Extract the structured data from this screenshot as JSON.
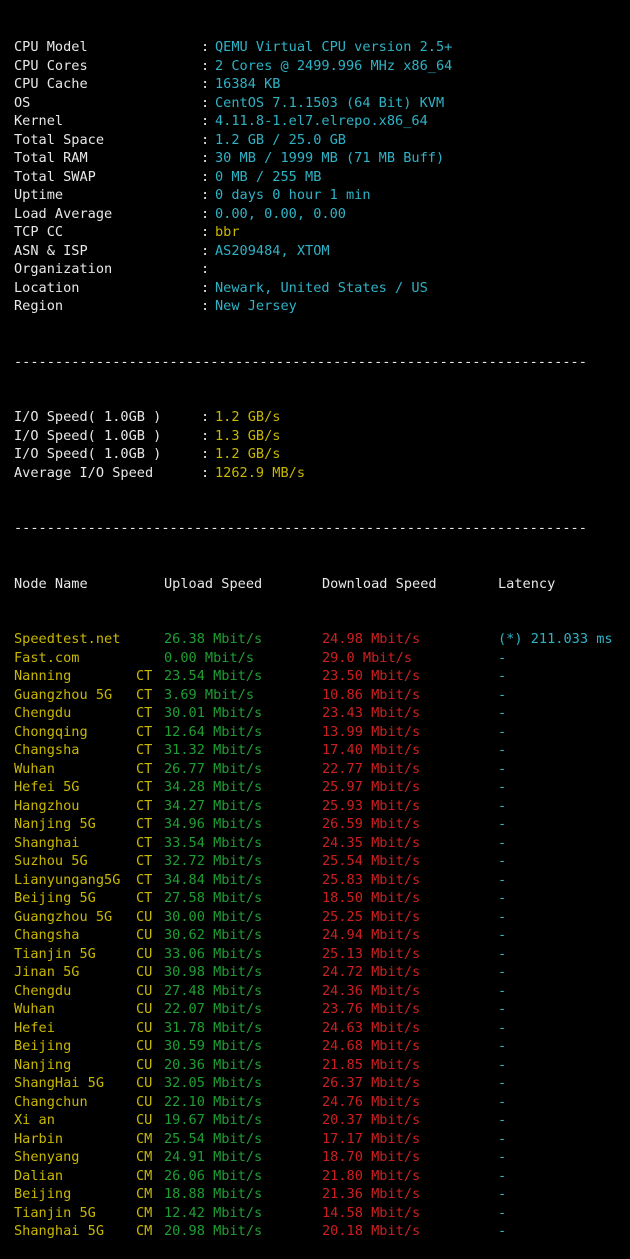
{
  "colors": {
    "background": "#000000",
    "label": "#e8e8e8",
    "value_yellow": "#c9b800",
    "value_cyan": "#2fb2c5",
    "upload_green": "#1f9e33",
    "download_red": "#cc2020"
  },
  "colon": ":",
  "system_info": [
    {
      "label": "CPU Model",
      "value": "QEMU Virtual CPU version 2.5+",
      "color": "cyan"
    },
    {
      "label": "CPU Cores",
      "value": "2 Cores @ 2499.996 MHz x86_64",
      "color": "cyan"
    },
    {
      "label": "CPU Cache",
      "value": "16384 KB",
      "color": "cyan"
    },
    {
      "label": "OS",
      "value": "CentOS 7.1.1503 (64 Bit) KVM",
      "color": "cyan"
    },
    {
      "label": "Kernel",
      "value": "4.11.8-1.el7.elrepo.x86_64",
      "color": "cyan"
    },
    {
      "label": "Total Space",
      "value": "1.2 GB / 25.0 GB",
      "color": "cyan"
    },
    {
      "label": "Total RAM",
      "value": "30 MB / 1999 MB (71 MB Buff)",
      "color": "cyan"
    },
    {
      "label": "Total SWAP",
      "value": "0 MB / 255 MB",
      "color": "cyan"
    },
    {
      "label": "Uptime",
      "value": "0 days 0 hour 1 min",
      "color": "cyan"
    },
    {
      "label": "Load Average",
      "value": "0.00, 0.00, 0.00",
      "color": "cyan"
    },
    {
      "label": "TCP CC",
      "value": "bbr",
      "color": "yellow"
    },
    {
      "label": "ASN & ISP",
      "value": "AS209484, XTOM",
      "color": "cyan"
    },
    {
      "label": "Organization",
      "value": "",
      "color": "cyan"
    },
    {
      "label": "Location",
      "value": "Newark, United States / US",
      "color": "cyan"
    },
    {
      "label": "Region",
      "value": "New Jersey",
      "color": "cyan"
    }
  ],
  "separator": "----------------------------------------------------------------------",
  "io_speed": [
    {
      "label": "I/O Speed( 1.0GB )",
      "value": "1.2 GB/s"
    },
    {
      "label": "I/O Speed( 1.0GB )",
      "value": "1.3 GB/s"
    },
    {
      "label": "I/O Speed( 1.0GB )",
      "value": "1.2 GB/s"
    },
    {
      "label": "Average I/O Speed",
      "value": "1262.9 MB/s"
    }
  ],
  "speed_header": {
    "node": "Node Name",
    "upload": "Upload Speed",
    "download": "Download Speed",
    "latency": "Latency"
  },
  "speed_rows": [
    {
      "node": "Speedtest.net",
      "isp": "",
      "upload": "26.38 Mbit/s",
      "download": "24.98 Mbit/s",
      "latency": "(*) 211.033 ms"
    },
    {
      "node": "Fast.com",
      "isp": "",
      "upload": "0.00 Mbit/s",
      "download": "29.0 Mbit/s",
      "latency": "-"
    },
    {
      "node": "Nanning",
      "isp": "CT",
      "upload": "23.54 Mbit/s",
      "download": "23.50 Mbit/s",
      "latency": "-"
    },
    {
      "node": "Guangzhou 5G",
      "isp": "CT",
      "upload": "3.69 Mbit/s",
      "download": "10.86 Mbit/s",
      "latency": "-"
    },
    {
      "node": "Chengdu",
      "isp": "CT",
      "upload": "30.01 Mbit/s",
      "download": "23.43 Mbit/s",
      "latency": "-"
    },
    {
      "node": "Chongqing",
      "isp": "CT",
      "upload": "12.64 Mbit/s",
      "download": "13.99 Mbit/s",
      "latency": "-"
    },
    {
      "node": "Changsha",
      "isp": "CT",
      "upload": "31.32 Mbit/s",
      "download": "17.40 Mbit/s",
      "latency": "-"
    },
    {
      "node": "Wuhan",
      "isp": "CT",
      "upload": "26.77 Mbit/s",
      "download": "22.77 Mbit/s",
      "latency": "-"
    },
    {
      "node": "Hefei 5G",
      "isp": "CT",
      "upload": "34.28 Mbit/s",
      "download": "25.97 Mbit/s",
      "latency": "-"
    },
    {
      "node": "Hangzhou",
      "isp": "CT",
      "upload": "34.27 Mbit/s",
      "download": "25.93 Mbit/s",
      "latency": "-"
    },
    {
      "node": "Nanjing 5G",
      "isp": "CT",
      "upload": "34.96 Mbit/s",
      "download": "26.59 Mbit/s",
      "latency": "-"
    },
    {
      "node": "Shanghai",
      "isp": "CT",
      "upload": "33.54 Mbit/s",
      "download": "24.35 Mbit/s",
      "latency": "-"
    },
    {
      "node": "Suzhou 5G",
      "isp": "CT",
      "upload": "32.72 Mbit/s",
      "download": "25.54 Mbit/s",
      "latency": "-"
    },
    {
      "node": "Lianyungang5G",
      "isp": "CT",
      "upload": "34.84 Mbit/s",
      "download": "25.83 Mbit/s",
      "latency": "-"
    },
    {
      "node": "Beijing 5G",
      "isp": "CT",
      "upload": "27.58 Mbit/s",
      "download": "18.50 Mbit/s",
      "latency": "-"
    },
    {
      "node": "Guangzhou 5G",
      "isp": "CU",
      "upload": "30.00 Mbit/s",
      "download": "25.25 Mbit/s",
      "latency": "-"
    },
    {
      "node": "Changsha",
      "isp": "CU",
      "upload": "30.62 Mbit/s",
      "download": "24.94 Mbit/s",
      "latency": "-"
    },
    {
      "node": "Tianjin 5G",
      "isp": "CU",
      "upload": "33.06 Mbit/s",
      "download": "25.13 Mbit/s",
      "latency": "-"
    },
    {
      "node": "Jinan 5G",
      "isp": "CU",
      "upload": "30.98 Mbit/s",
      "download": "24.72 Mbit/s",
      "latency": "-"
    },
    {
      "node": "Chengdu",
      "isp": "CU",
      "upload": "27.48 Mbit/s",
      "download": "24.36 Mbit/s",
      "latency": "-"
    },
    {
      "node": "Wuhan",
      "isp": "CU",
      "upload": "22.07 Mbit/s",
      "download": "23.76 Mbit/s",
      "latency": "-"
    },
    {
      "node": "Hefei",
      "isp": "CU",
      "upload": "31.78 Mbit/s",
      "download": "24.63 Mbit/s",
      "latency": "-"
    },
    {
      "node": "Beijing",
      "isp": "CU",
      "upload": "30.59 Mbit/s",
      "download": "24.68 Mbit/s",
      "latency": "-"
    },
    {
      "node": "Nanjing",
      "isp": "CU",
      "upload": "20.36 Mbit/s",
      "download": "21.85 Mbit/s",
      "latency": "-"
    },
    {
      "node": "ShangHai 5G",
      "isp": "CU",
      "upload": "32.05 Mbit/s",
      "download": "26.37 Mbit/s",
      "latency": "-"
    },
    {
      "node": "Changchun",
      "isp": "CU",
      "upload": "22.10 Mbit/s",
      "download": "24.76 Mbit/s",
      "latency": "-"
    },
    {
      "node": "Xi an",
      "isp": "CU",
      "upload": "19.67 Mbit/s",
      "download": "20.37 Mbit/s",
      "latency": "-"
    },
    {
      "node": "Harbin",
      "isp": "CM",
      "upload": "25.54 Mbit/s",
      "download": "17.17 Mbit/s",
      "latency": "-"
    },
    {
      "node": "Shenyang",
      "isp": "CM",
      "upload": "24.91 Mbit/s",
      "download": "18.70 Mbit/s",
      "latency": "-"
    },
    {
      "node": "Dalian",
      "isp": "CM",
      "upload": "26.06 Mbit/s",
      "download": "21.80 Mbit/s",
      "latency": "-"
    },
    {
      "node": "Beijing",
      "isp": "CM",
      "upload": "18.88 Mbit/s",
      "download": "21.36 Mbit/s",
      "latency": "-"
    },
    {
      "node": "Tianjin 5G",
      "isp": "CM",
      "upload": "12.42 Mbit/s",
      "download": "14.58 Mbit/s",
      "latency": "-"
    },
    {
      "node": "Shanghai 5G",
      "isp": "CM",
      "upload": "20.98 Mbit/s",
      "download": "20.18 Mbit/s",
      "latency": "-"
    }
  ]
}
